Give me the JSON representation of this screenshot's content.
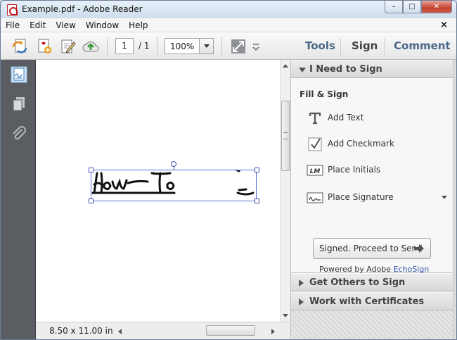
{
  "window": {
    "title": "Example.pdf - Adobe Reader",
    "controls": {
      "minimize": "–",
      "maximize": "□",
      "close": "✕"
    }
  },
  "menu": {
    "items": [
      "File",
      "Edit",
      "View",
      "Window",
      "Help"
    ],
    "close_glyph": "×"
  },
  "toolbar": {
    "page_current": "1",
    "page_total": "/ 1",
    "zoom": "100%",
    "tabs": [
      "Tools",
      "Sign",
      "Comment"
    ],
    "active_tab": "Sign"
  },
  "status": {
    "page_size": "8.50 x 11.00 in"
  },
  "signature": {
    "text": "How—To"
  },
  "panel": {
    "section_i_need_to_sign": "I Need to Sign",
    "fill_sign_label": "Fill & Sign",
    "actions": [
      {
        "icon": "text-tool-icon",
        "label": "Add Text"
      },
      {
        "icon": "checkmark-icon",
        "label": "Add Checkmark"
      },
      {
        "icon": "initials-icon",
        "label": "Place Initials"
      },
      {
        "icon": "signature-icon",
        "label": "Place Signature"
      }
    ],
    "initials_glyph": "LM",
    "proceed_button": "Signed. Proceed to Send",
    "powered_by": "Powered by Adobe",
    "powered_link": "EchoSign",
    "section_get_others": "Get Others to Sign",
    "section_certificates": "Work with Certificates"
  },
  "colors": {
    "tab_blue": "#4a6787",
    "selection_blue": "#3e4fb7",
    "nav_dark": "#5a5d62",
    "link_blue": "#2a4fa6"
  }
}
